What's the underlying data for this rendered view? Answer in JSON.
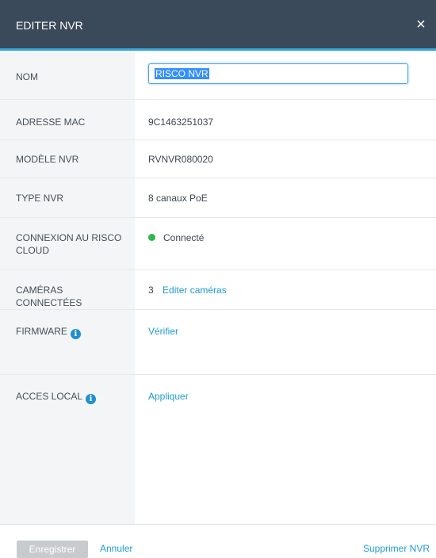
{
  "dialog": {
    "title": "EDITER NVR",
    "close_glyph": "×"
  },
  "fields": {
    "name": {
      "label": "NOM",
      "value": "RISCO NVR"
    },
    "mac": {
      "label": "ADRESSE MAC",
      "value": "9C1463251037"
    },
    "model": {
      "label": "MODÈLE NVR",
      "value": "RVNVR080020"
    },
    "type": {
      "label": "TYPE NVR",
      "value": "8 canaux PoE"
    },
    "cloud": {
      "label": "CONNEXION AU RISCO CLOUD",
      "status": "Connecté",
      "status_color": "#2eb84a"
    },
    "cameras": {
      "label": "CAMÉRAS CONNECTÉES",
      "count": "3",
      "link": "Editer caméras"
    },
    "firmware": {
      "label": "FIRMWARE",
      "link": "Vérifier",
      "info_icon": "info-icon"
    },
    "local_access": {
      "label": "ACCES LOCAL",
      "link": "Appliquer",
      "info_icon": "info-icon"
    }
  },
  "footer": {
    "save_label": "Enregistrer",
    "cancel_label": "Annuler",
    "delete_label": "Supprimer NVR"
  },
  "colors": {
    "header_bg": "#3b4a5a",
    "accent": "#38a8d8",
    "link": "#1f9bd1"
  }
}
